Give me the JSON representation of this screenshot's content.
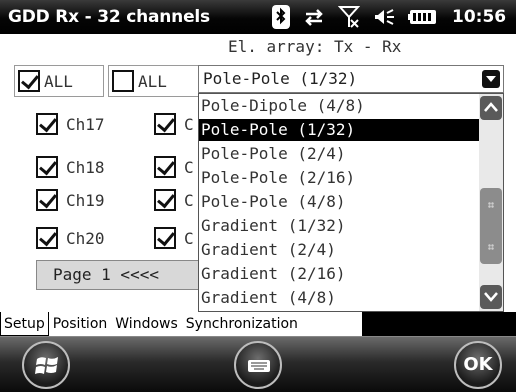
{
  "titlebar": {
    "title": "GDD Rx - 32 channels",
    "clock": "10:56",
    "icons": [
      "bluetooth-icon",
      "data-transfer-icon",
      "no-signal-icon",
      "volume-icon",
      "battery-icon"
    ]
  },
  "header": {
    "array_label": "El. array: Tx - Rx"
  },
  "toggles": {
    "all_checked_label": "ALL",
    "all_unchecked_label": "ALL"
  },
  "combo": {
    "selected": "Pole-Pole (1/32)"
  },
  "channels": {
    "ch17": "Ch17",
    "ch18": "Ch18",
    "ch19": "Ch19",
    "ch20": "Ch20",
    "col2_prefix": "C"
  },
  "pager": {
    "label": "Page 1 <<<<"
  },
  "dropdown": {
    "options": [
      "Pole-Dipole (4/8)",
      "Pole-Pole (1/32)",
      "Pole-Pole (2/4)",
      "Pole-Pole (2/16)",
      "Pole-Pole (4/8)",
      "Gradient (1/32)",
      "Gradient (2/4)",
      "Gradient (2/16)",
      "Gradient (4/8)"
    ],
    "selected_index": 1
  },
  "tabs": {
    "setup": "Setup",
    "position": "Position",
    "windows": "Windows",
    "synchronization": "Synchronization"
  },
  "softkeys": {
    "ok": "OK"
  },
  "colors": {
    "selection": "#000000",
    "background": "#ffffff",
    "bar": "#000000"
  }
}
